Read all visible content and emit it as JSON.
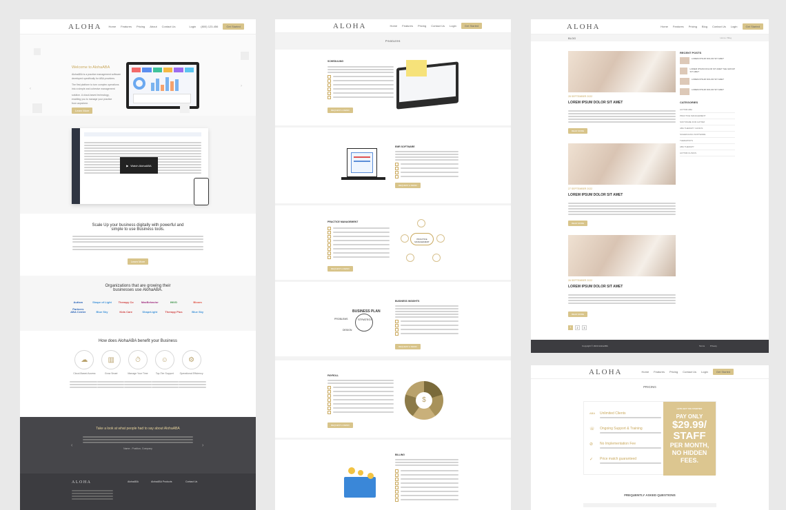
{
  "brand": {
    "logo": "ALOHA",
    "tagline": "PRACTICE MANAGEMENT"
  },
  "colors": {
    "gold": "#d8c48a",
    "dark": "#46464a",
    "bg": "#e9e9e9"
  },
  "site1": {
    "nav": [
      "Home",
      "Features",
      "Pricing",
      "About",
      "Contact Us"
    ],
    "login": "Login",
    "phone": "(800) 123-456",
    "cta": "Get Started",
    "hero_title": "Welcome to AlohaABA",
    "hero_text": [
      "AlohaABA is a practice management software",
      "developed specifically for ABA providers.",
      "The first platform to turn complex operations",
      "into a simple and cohesive management",
      "solution. A cloud-based technology,",
      "enabling you to manage your practice",
      "from anywhere."
    ],
    "hero_btn": "Learn More",
    "video_title": "Watch AlohaABA",
    "scale_title_1": "Scale Up your business digitally with powerful and",
    "scale_title_2": "simple to use Business tools.",
    "scale_btn": "Learn More",
    "orgs_title_1": "Organizations that are growing their",
    "orgs_title_2": "businesses use AlohaABA.",
    "clients": [
      "Autism Partners",
      "Shape of Light",
      "Therapy Co",
      "MaxBehavior",
      "INVO",
      "Bloom",
      "ABA Center",
      "Blue Sky",
      "Kids Care",
      "ShapeLight",
      "Therapy Plus",
      "Blue Sky"
    ],
    "benefit_title": "How does AlohaABA benefit your Business",
    "benefits": [
      {
        "icon": "☁",
        "label": "Cloud-Based Access"
      },
      {
        "icon": "▥",
        "label": "Grow Smart"
      },
      {
        "icon": "⏱",
        "label": "Manage Your Time"
      },
      {
        "icon": "☺",
        "label": "Top-Tier Support"
      },
      {
        "icon": "⚙",
        "label": "Operational Efficiency"
      }
    ],
    "testimonial_title": "Take a look at what people had to say about AlohaABA",
    "testimonial_author": "Name - Position, Company",
    "footer_cols": [
      "AlohaABA",
      "AlohaABA Products",
      "Contact Us"
    ]
  },
  "site2": {
    "nav": [
      "Home",
      "Features",
      "Pricing",
      "Contact Us",
      "Login"
    ],
    "cta": "Get Started",
    "page_title": "Features",
    "sections": [
      {
        "title": "SCHEDULING",
        "btn": "REQUEST A DEMO"
      },
      {
        "title": "EMR SOFTWARE",
        "btn": "REQUEST A DEMO"
      },
      {
        "title": "PRACTICE MANAGEMENT",
        "btn": "REQUEST A DEMO"
      },
      {
        "title": "BUSINESS INSIGHTS",
        "btn": "REQUEST A DEMO"
      },
      {
        "title": "PAYROLL",
        "btn": "REQUEST A DEMO"
      },
      {
        "title": "BILLING",
        "btn": "REQUEST A DEMO"
      }
    ],
    "diagram_labels": {
      "practice": "PRACTICE MANAGEMENT",
      "bplan": "BUSINESS PLAN",
      "strategy": "STRATEGY",
      "problem": "PROBLEMS",
      "design": "DESIGN"
    }
  },
  "site3": {
    "nav": [
      "Home",
      "Features",
      "Pricing",
      "Blog",
      "Contact Us",
      "Login"
    ],
    "cta": "Get Started",
    "breadcrumb": "BLOG",
    "breadcrumb_right": "Home / Blog",
    "posts": [
      {
        "date": "28 SEPTEMBER 2022",
        "title": "LOREM IPSUM DOLOR SIT AMET",
        "btn": "READ MORE"
      },
      {
        "date": "27 SEPTEMBER 2022",
        "title": "LOREM IPSUM DOLOR SIT AMET",
        "btn": "READ MORE"
      },
      {
        "date": "26 SEPTEMBER 2022",
        "title": "LOREM IPSUM DOLOR SIT AMET",
        "btn": "READ MORE"
      }
    ],
    "recent_title": "RECENT POSTS",
    "recent": [
      "LOREM IPSUM DOLOR SIT AMET",
      "LOREM IPSUM DOLOR SIT AMET THE GROUP SIT AMET",
      "LOREM IPSUM DOLOR SIT AMET",
      "LOREM IPSUM DOLOR SIT AMET"
    ],
    "categories_title": "CATEGORIES",
    "categories": [
      "AUTISM ABA",
      "PRACTICE MANAGEMENT",
      "SOFTWARE FOR AUTISM",
      "ABA THERAPY CLINICS",
      "SCHEDULING SOFTWARE",
      "THERAPISTS",
      "ABA THERAPY",
      "AUTISM CLINICS"
    ],
    "pages": [
      "1",
      "2",
      "3"
    ],
    "footer": "Copyright © 2022 AlohaABA",
    "footer_links": [
      "Terms",
      "Privacy"
    ]
  },
  "site4": {
    "nav": [
      "Home",
      "Features",
      "Pricing",
      "Contact Us",
      "Login"
    ],
    "cta": "Get Started",
    "title": "PRICING",
    "features": [
      {
        "name": "Unlimited Clients",
        "icon": "ABA"
      },
      {
        "name": "Ongoing Support & Training",
        "icon": "☏"
      },
      {
        "name": "No Implementation Fee",
        "icon": "⊘"
      },
      {
        "name": "Price match guaranteed",
        "icon": "✓"
      }
    ],
    "gold_top": "LETS GET YOU STARTED",
    "pay_only": "PAY ONLY",
    "price": "$29.99/",
    "unit": "STAFF",
    "per": "PER MONTH,",
    "no_fees": "NO HIDDEN",
    "fees": "FEES.",
    "faq": "FREQUENTLY ASKED QUESTIONS"
  }
}
